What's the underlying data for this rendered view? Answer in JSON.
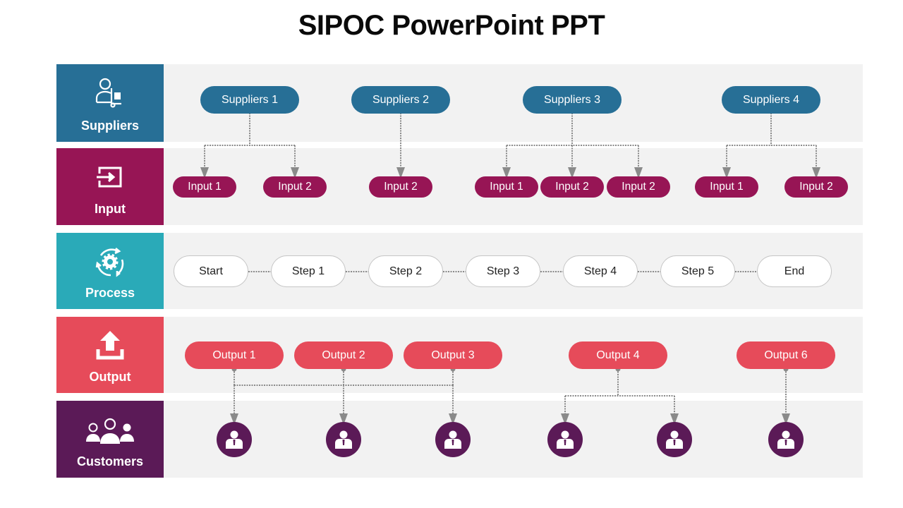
{
  "title": "SIPOC PowerPoint PPT",
  "colors": {
    "suppliers": "#276f96",
    "input": "#971555",
    "process": "#2aaab8",
    "output": "#e64b5a",
    "customers": "#5b1a57",
    "row_background": "#f2f2f2",
    "connector": "#8a8a8a"
  },
  "rows": [
    {
      "key": "suppliers",
      "label": "Suppliers",
      "icon": "supplier-trolley-icon"
    },
    {
      "key": "input",
      "label": "Input",
      "icon": "input-arrow-icon"
    },
    {
      "key": "process",
      "label": "Process",
      "icon": "process-cycle-gear-icon"
    },
    {
      "key": "output",
      "label": "Output",
      "icon": "upload-arrow-icon"
    },
    {
      "key": "customers",
      "label": "Customers",
      "icon": "customers-group-icon"
    }
  ],
  "suppliers": [
    "Suppliers 1",
    "Suppliers 2",
    "Suppliers 3",
    "Suppliers 4"
  ],
  "inputs": [
    {
      "label": "Input 1",
      "from": "Suppliers 1"
    },
    {
      "label": "Input 2",
      "from": "Suppliers 1"
    },
    {
      "label": "Input 2",
      "from": "Suppliers 2"
    },
    {
      "label": "Input 1",
      "from": "Suppliers 3"
    },
    {
      "label": "Input 2",
      "from": "Suppliers 3"
    },
    {
      "label": "Input 2",
      "from": "Suppliers 3"
    },
    {
      "label": "Input 1",
      "from": "Suppliers 4"
    },
    {
      "label": "Input 2",
      "from": "Suppliers 4"
    }
  ],
  "process_steps": [
    "Start",
    "Step 1",
    "Step 2",
    "Step 3",
    "Step 4",
    "Step 5",
    "End"
  ],
  "outputs": [
    "Output 1",
    "Output 2",
    "Output 3",
    "Output 4",
    "Output 6"
  ],
  "customers": [
    {
      "icon": "customer-icon",
      "from": "Output 1"
    },
    {
      "icon": "customer-icon",
      "from": "Output 2"
    },
    {
      "icon": "customer-icon",
      "from": "Output 3"
    },
    {
      "icon": "customer-icon",
      "from": "Output 4"
    },
    {
      "icon": "customer-icon",
      "from": "Output 4"
    },
    {
      "icon": "customer-icon",
      "from": "Output 6"
    }
  ]
}
